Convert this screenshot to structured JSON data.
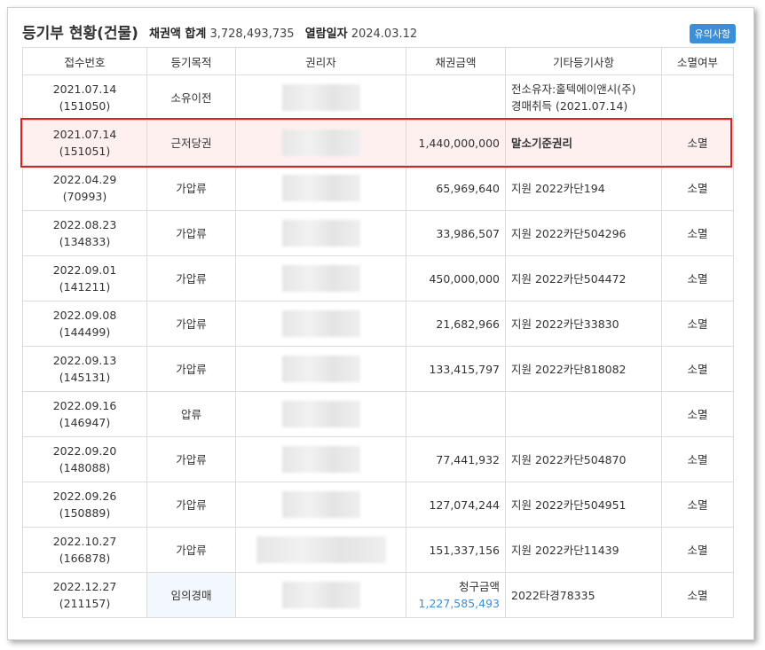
{
  "header": {
    "title": "등기부 현황(건물)",
    "total_label": "채권액 합계",
    "total_value": "3,728,493,735",
    "date_label": "열람일자",
    "date_value": "2024.03.12",
    "notice_button": "유의사항"
  },
  "columns": [
    "접수번호",
    "등기목적",
    "권리자",
    "채권금액",
    "기타등기사항",
    "소멸여부"
  ],
  "rows": [
    {
      "date": "2021.07.14",
      "no": "(151050)",
      "purpose": "소유이전",
      "amount": "",
      "etc1": "전소유자:홀텍에이앤시(주)",
      "etc2": "경매취득 (2021.07.14)",
      "status": ""
    },
    {
      "date": "2021.07.14",
      "no": "(151051)",
      "purpose": "근저당권",
      "amount": "1,440,000,000",
      "etc1": "말소기준권리",
      "etc2": "",
      "status": "소멸"
    },
    {
      "date": "2022.04.29",
      "no": "(70993)",
      "purpose": "가압류",
      "amount": "65,969,640",
      "etc1": "지원 2022카단194",
      "etc2": "",
      "status": "소멸"
    },
    {
      "date": "2022.08.23",
      "no": "(134833)",
      "purpose": "가압류",
      "amount": "33,986,507",
      "etc1": "지원 2022카단504296",
      "etc2": "",
      "status": "소멸"
    },
    {
      "date": "2022.09.01",
      "no": "(141211)",
      "purpose": "가압류",
      "amount": "450,000,000",
      "etc1": "지원 2022카단504472",
      "etc2": "",
      "status": "소멸"
    },
    {
      "date": "2022.09.08",
      "no": "(144499)",
      "purpose": "가압류",
      "amount": "21,682,966",
      "etc1": "지원 2022카단33830",
      "etc2": "",
      "status": "소멸"
    },
    {
      "date": "2022.09.13",
      "no": "(145131)",
      "purpose": "가압류",
      "amount": "133,415,797",
      "etc1": "지원 2022카단818082",
      "etc2": "",
      "status": "소멸"
    },
    {
      "date": "2022.09.16",
      "no": "(146947)",
      "purpose": "압류",
      "amount": "",
      "etc1": "",
      "etc2": "",
      "status": "소멸"
    },
    {
      "date": "2022.09.20",
      "no": "(148088)",
      "purpose": "가압류",
      "amount": "77,441,932",
      "etc1": "지원 2022카단504870",
      "etc2": "",
      "status": "소멸"
    },
    {
      "date": "2022.09.26",
      "no": "(150889)",
      "purpose": "가압류",
      "amount": "127,074,244",
      "etc1": "지원 2022카단504951",
      "etc2": "",
      "status": "소멸"
    },
    {
      "date": "2022.10.27",
      "no": "(166878)",
      "purpose": "가압류",
      "amount": "151,337,156",
      "etc1": "지원 2022카단11439",
      "etc2": "",
      "status": "소멸"
    },
    {
      "date": "2022.12.27",
      "no": "(211157)",
      "purpose": "임의경매",
      "amount_label": "청구금액",
      "amount": "1,227,585,493",
      "etc1": "2022타경78335",
      "etc2": "",
      "status": "소멸"
    }
  ],
  "colors": {
    "accent": "#3b8fd8",
    "highlight_border": "#e02020",
    "highlight_bg": "#fff0f0"
  }
}
